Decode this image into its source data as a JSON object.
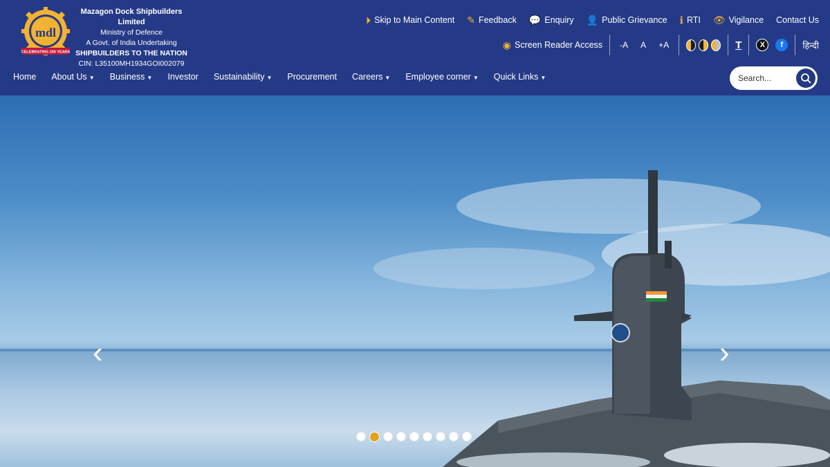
{
  "org": {
    "name": "Mazagon Dock Shipbuilders Limited",
    "ministry": "Ministry of Defence",
    "undertaking": "A Govt. of India Undertaking",
    "tagline": "SHIPBUILDERS TO THE NATION",
    "cin": "CIN: L35100MH1934GOI002079",
    "logo_text": "mdl",
    "logo_banner": "CELEBRATING 250 YEARS"
  },
  "utility": {
    "skip": "Skip to Main Content",
    "feedback": "Feedback",
    "enquiry": "Enquiry",
    "grievance": "Public Grievance",
    "rti": "RTI",
    "vigilance": "Vigilance",
    "contact": "Contact Us",
    "screen_reader": "Screen Reader Access",
    "font_decrease": "-A",
    "font_normal": "A",
    "font_increase": "+A",
    "social_x": "X",
    "social_fb": "f",
    "language": "हिन्दी"
  },
  "nav": {
    "items": [
      {
        "label": "Home"
      },
      {
        "label": "About Us"
      },
      {
        "label": "Business"
      },
      {
        "label": "Investor"
      },
      {
        "label": "Sustainability"
      },
      {
        "label": "Procurement"
      },
      {
        "label": "Careers"
      },
      {
        "label": "Employee corner"
      },
      {
        "label": "Quick Links"
      }
    ]
  },
  "search": {
    "placeholder": "Search..."
  },
  "hero": {
    "prev_arrow": "‹",
    "next_arrow": "›",
    "slide_count": 9,
    "active_slide": 2
  },
  "colors": {
    "header_bg": "#253a86",
    "accent_gold": "#f2b233",
    "active_dot": "#e0a11b"
  }
}
